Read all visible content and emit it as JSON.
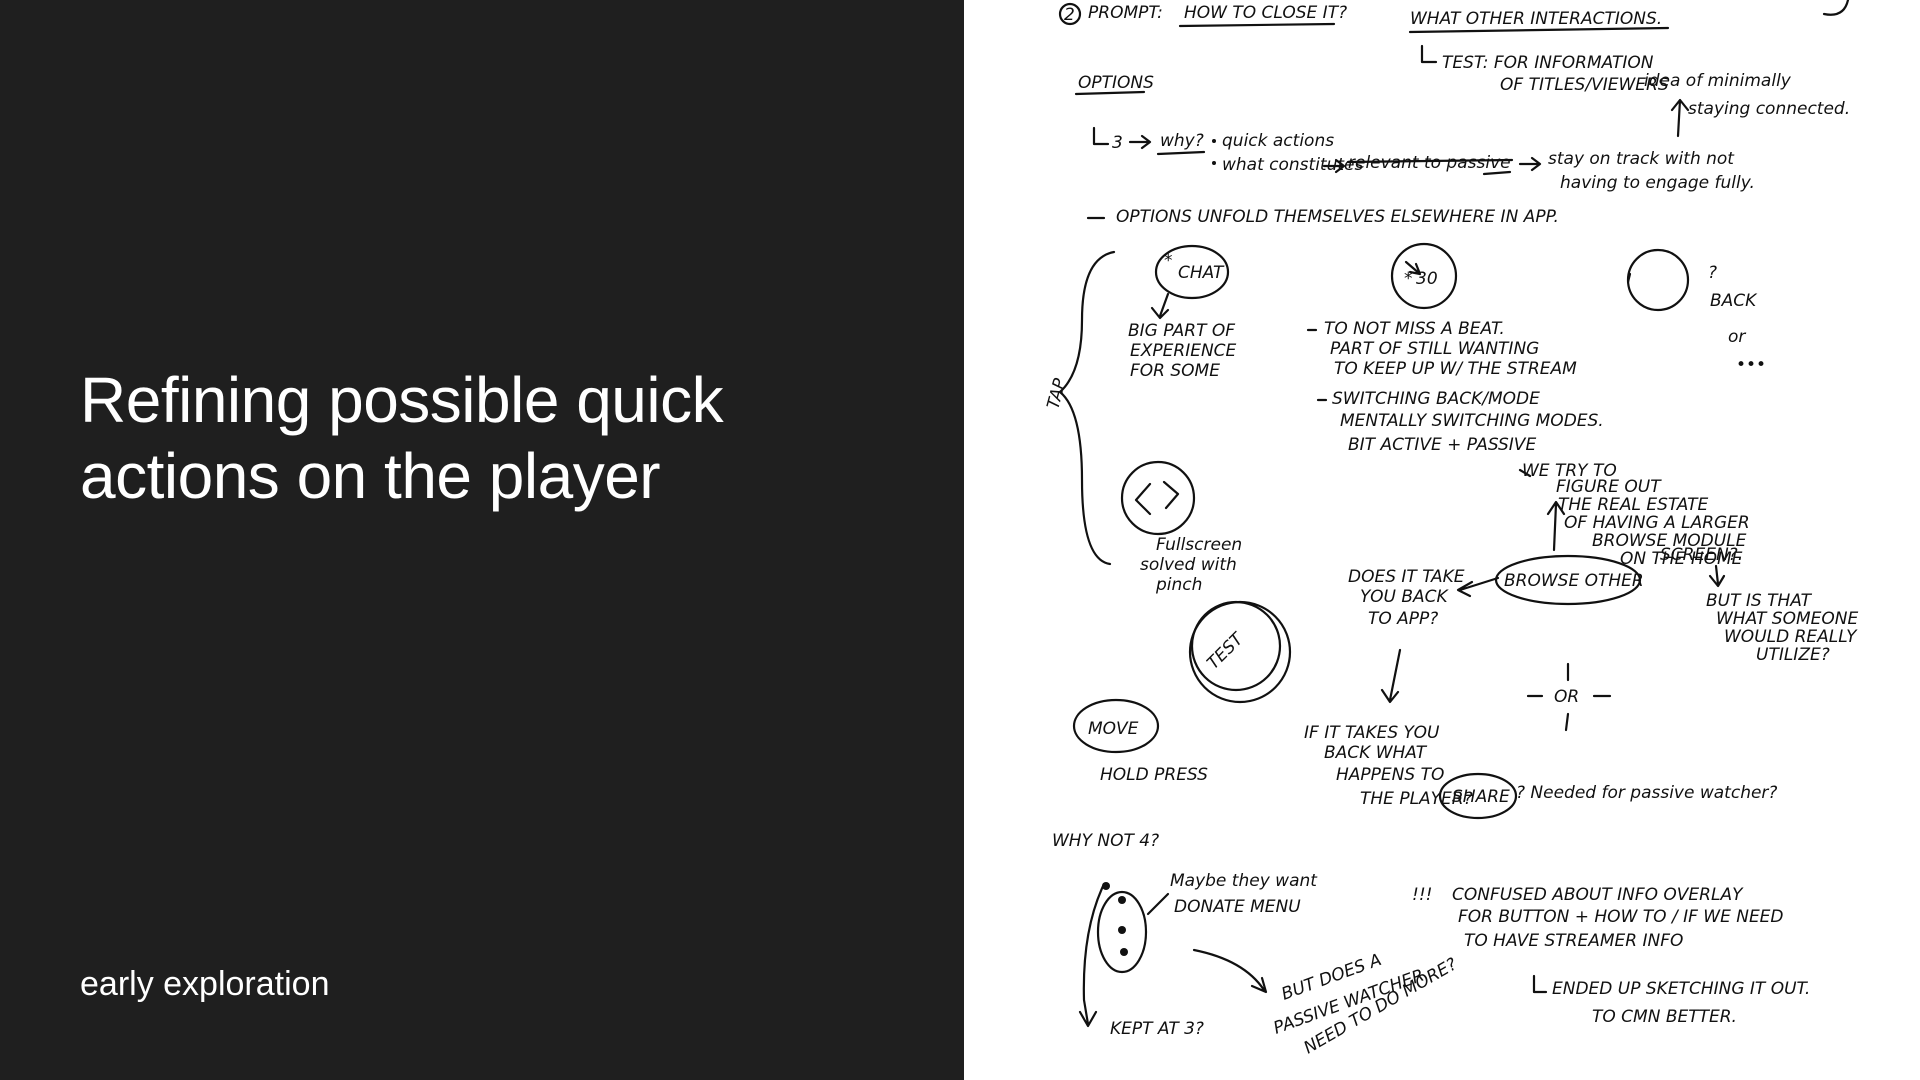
{
  "slide": {
    "title": "Refining possible quick actions on the player",
    "subtitle": "early exploration",
    "colors": {
      "left_background": "#1f1f1f",
      "text": "#ffffff",
      "right_background": "#ffffff",
      "ink": "#111111"
    }
  },
  "sketch": {
    "prompt_number": "2",
    "prompt_label": "PROMPT:",
    "prompt_question": "HOW TO CLOSE IT?",
    "other_interactions": "WHAT OTHER INTERACTIONS.",
    "test_note_line1": "TEST: FOR INFORMATION",
    "test_note_line2": "OF TITLES/VIEWERS",
    "idea_line1": "idea of minimally",
    "idea_line2": "staying connected.",
    "options_heading": "OPTIONS",
    "why_number": "3",
    "why_label": "why?",
    "why_bullet1": "quick actions",
    "why_bullet2": "what constitutes",
    "struck_text": "relevant to passive",
    "stay_line1": "stay on track with not",
    "stay_line2": "having to engage fully.",
    "options_unfold": "OPTIONS UNFOLD THEMSELVES ELSEWHERE IN APP.",
    "tap_label": "TAP",
    "chat_label": "CHAT",
    "chat_note_line1": "BIG PART OF",
    "chat_note_line2": "EXPERIENCE",
    "chat_note_line3": "FOR SOME",
    "skip_label": "30",
    "skip_note_line1": "TO NOT MISS A BEAT.",
    "skip_note_line2": "PART OF STILL WANTING",
    "skip_note_line3": "TO KEEP UP W/ THE STREAM",
    "switch_note_line1": "SWITCHING BACK/MODE",
    "switch_note_line2": "MENTALLY SWITCHING MODES.",
    "switch_note_line3": "BIT ACTIVE + PASSIVE",
    "question_mark": "?",
    "back_label": "BACK",
    "or_label": "or",
    "ellipsis": "•••",
    "fullscreen_line1": "Fullscreen",
    "fullscreen_line2": "solved with",
    "fullscreen_line3": "pinch",
    "figure_out_line1": "WE TRY TO",
    "figure_out_line2": "FIGURE OUT",
    "figure_out_line3": "THE REAL ESTATE",
    "figure_out_line4": "OF HAVING A LARGER",
    "figure_out_line5": "BROWSE MODULE",
    "figure_out_line6": "ON THE HOME",
    "figure_out_line7": "SCREEN?.",
    "browse_other": "BROWSE OTHER",
    "take_back_line1": "DOES IT TAKE",
    "take_back_line2": "YOU BACK",
    "take_back_line3": "TO APP?",
    "test_label": "TEST",
    "utilize_line1": "BUT IS THAT",
    "utilize_line2": "WHAT SOMEONE",
    "utilize_line3": "WOULD REALLY",
    "utilize_line4": "UTILIZE?",
    "plus_or": "OR",
    "move_label": "MOVE",
    "hold_press": "HOLD PRESS",
    "player_line1": "IF IT TAKES YOU",
    "player_line2": "BACK WHAT",
    "player_line3": "HAPPENS TO",
    "player_line4": "THE PLAYER?",
    "share_label": "SHARE",
    "share_note": "? Needed for passive watcher?",
    "why_not_four": "WHY NOT 4?",
    "donate_line1": "Maybe they want",
    "donate_line2": "DONATE MENU",
    "exclaim": "!!!",
    "confused_line1": "CONFUSED ABOUT INFO OVERLAY",
    "confused_line2": "FOR BUTTON + HOW TO / IF WE NEED",
    "confused_line3": "TO HAVE STREAMER INFO",
    "but_does_line1": "BUT DOES A",
    "but_does_line2": "PASSIVE WATCHER",
    "but_does_line3": "NEED TO DO MORE?",
    "kept_at_three": "KEPT AT 3?",
    "ended_line1": "ENDED UP SKETCHING IT OUT.",
    "ended_line2": "TO CMN BETTER."
  }
}
